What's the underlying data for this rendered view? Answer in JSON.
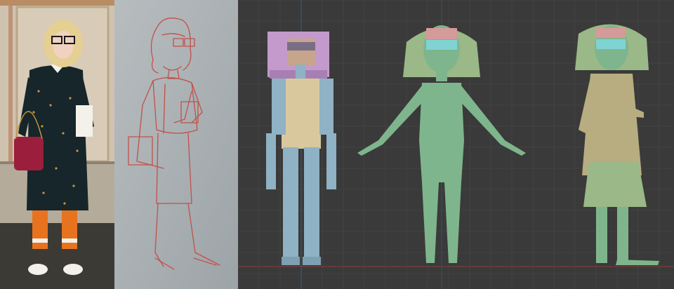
{
  "colors": {
    "photo_wall": "#cfc3b0",
    "photo_floor": "#3b3a35",
    "coat": "#16262a",
    "socks": "#e8731f",
    "bag": "#9b1e3c",
    "hair": "#e6cf93",
    "sketch_paper": "#a9b0b3",
    "sketch_line": "#c2504a",
    "viewport_bg": "#3a3a3a",
    "grid_line": "#434343",
    "blue_model": "#8fb2c4",
    "tan_torso": "#d9c89e",
    "purple_hair": "#c39acb",
    "green_model": "#7fb58c",
    "pink_face": "#d59a9a",
    "cyan_glasses": "#7fd3d3",
    "coat_model": "#b8ad80",
    "skirt_model": "#9bb888"
  },
  "panels": [
    "reference-photo",
    "pencil-sketch",
    "3d-viewport"
  ]
}
